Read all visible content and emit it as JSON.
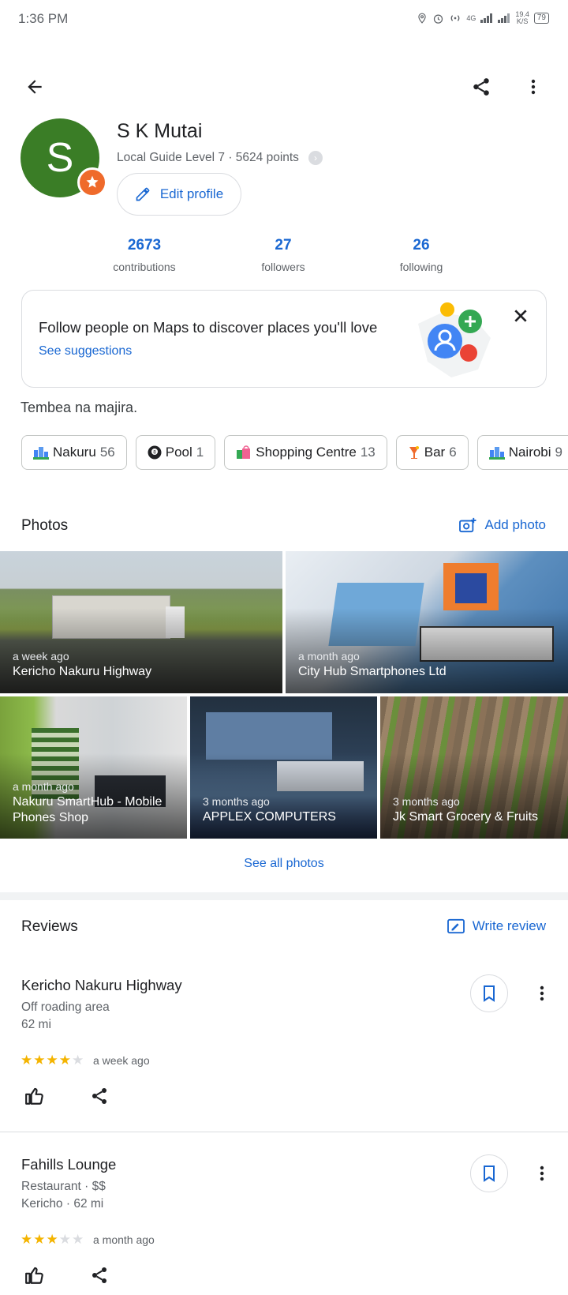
{
  "status_bar": {
    "time": "1:36 PM",
    "net_speed": "19.4",
    "net_unit": "K/S",
    "net_type": "4G",
    "battery": "79"
  },
  "profile": {
    "initial": "S",
    "name": "S K Mutai",
    "level": "Local Guide Level 7 · 5624 points",
    "edit_label": "Edit profile"
  },
  "stats": [
    {
      "value": "2673",
      "label": "contributions"
    },
    {
      "value": "27",
      "label": "followers"
    },
    {
      "value": "26",
      "label": "following"
    }
  ],
  "follow_card": {
    "text": "Follow people on Maps to discover places you'll love",
    "link": "See suggestions"
  },
  "bio": "Tembea na majira.",
  "chips": [
    {
      "label": "Nakuru",
      "count": "56",
      "icon": "city-icon"
    },
    {
      "label": "Pool",
      "count": "1",
      "icon": "billiard-ball-icon"
    },
    {
      "label": "Shopping Centre",
      "count": "13",
      "icon": "shopping-bags-icon"
    },
    {
      "label": "Bar",
      "count": "6",
      "icon": "cocktail-icon"
    },
    {
      "label": "Nairobi",
      "count": "9",
      "icon": "city-icon"
    }
  ],
  "photos": {
    "title": "Photos",
    "add_label": "Add photo",
    "items": [
      {
        "when": "a week ago",
        "place": "Kericho Nakuru Highway"
      },
      {
        "when": "a month ago",
        "place": "City Hub Smartphones Ltd"
      },
      {
        "when": "a month ago",
        "place": "Nakuru SmartHub - Mobile Phones Shop"
      },
      {
        "when": "3 months ago",
        "place": "APPLEX COMPUTERS"
      },
      {
        "when": "3 months ago",
        "place": "Jk Smart Grocery & Fruits"
      }
    ],
    "see_all": "See all photos"
  },
  "reviews": {
    "title": "Reviews",
    "write_label": "Write review",
    "items": [
      {
        "place": "Kericho Nakuru Highway",
        "line1": "Off roading area",
        "line2": "62 mi",
        "rating": 4,
        "when": "a week ago"
      },
      {
        "place": "Fahills Lounge",
        "line1": "Restaurant · $$",
        "line2": "Kericho · 62 mi",
        "rating": 3,
        "when": "a month ago"
      }
    ]
  },
  "colors": {
    "accent": "#1967d2",
    "avatar": "#3a7d26",
    "badge": "#ef6a2b",
    "star": "#f4b400"
  }
}
